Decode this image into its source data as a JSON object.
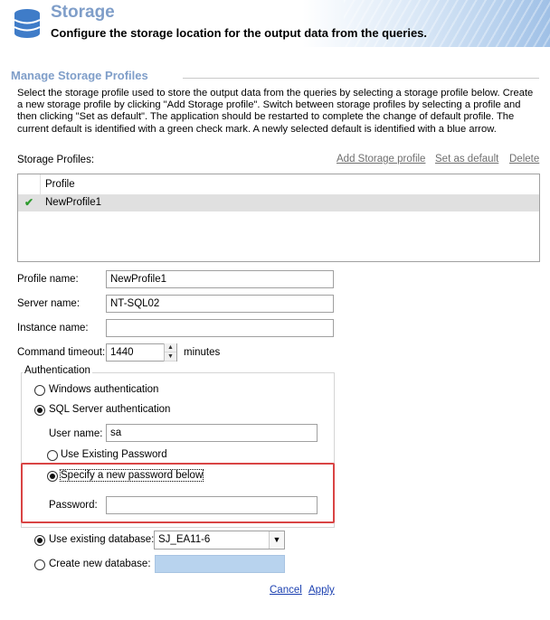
{
  "header": {
    "title": "Storage",
    "subtitle": "Configure the storage location for the output data from the queries."
  },
  "section": {
    "title": "Manage Storage Profiles",
    "description": "Select the storage profile used to store the output data from the queries by selecting a storage profile below. Create a new storage profile by clicking \"Add Storage profile\". Switch between storage profiles by selecting a profile and then clicking \"Set as default\". The application should be restarted to complete the change of default profile. The current default is identified with a green check mark. A newly selected default is identified with a blue arrow."
  },
  "profiles": {
    "label": "Storage Profiles:",
    "add_link": "Add Storage profile",
    "set_default_link": "Set as default",
    "delete_link": "Delete",
    "column_header": "Profile",
    "rows": [
      {
        "name": "NewProfile1",
        "is_default": true
      }
    ]
  },
  "form": {
    "profile_name_label": "Profile name:",
    "profile_name_value": "NewProfile1",
    "server_name_label": "Server name:",
    "server_name_value": "NT-SQL02",
    "instance_name_label": "Instance name:",
    "instance_name_value": "",
    "command_timeout_label": "Command timeout:",
    "command_timeout_value": "1440",
    "command_timeout_unit": "minutes"
  },
  "auth": {
    "legend": "Authentication",
    "windows_label": "Windows authentication",
    "sql_label": "SQL Server authentication",
    "selected": "sql",
    "user_name_label": "User name:",
    "user_name_value": "sa",
    "use_existing_password_label": "Use Existing Password",
    "specify_new_password_label": "Specify a new password below",
    "password_mode": "new",
    "password_label": "Password:",
    "password_value": ""
  },
  "database": {
    "use_existing_label": "Use existing database:",
    "existing_value": "SJ_EA11-6",
    "create_new_label": "Create new database:",
    "selected": "existing"
  },
  "footer": {
    "cancel_label": "Cancel",
    "apply_label": "Apply"
  },
  "colors": {
    "title": "#7f9ec9",
    "highlight": "#d94444",
    "default_check": "#2e9b2e"
  },
  "icons": {
    "header": "database-icon",
    "default_marker": "check-icon"
  }
}
